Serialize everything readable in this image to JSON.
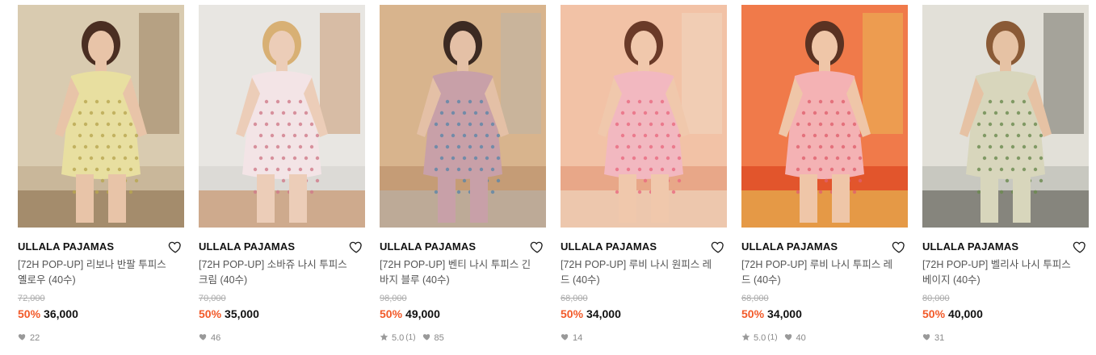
{
  "products": [
    {
      "brand": "ULLALA PAJAMAS",
      "name": "[72H POP-UP] 리보나 반팔 투피스 옐로우 (40수)",
      "original_price": "72,000",
      "discount": "50%",
      "price": "36,000",
      "rating": "",
      "review_count": "",
      "likes": "22",
      "image_alt": "yellow floral short-sleeve two-piece pajama"
    },
    {
      "brand": "ULLALA PAJAMAS",
      "name": "[72H POP-UP] 소바쥬 나시 투피스 크림 (40수)",
      "original_price": "70,000",
      "discount": "50%",
      "price": "35,000",
      "rating": "",
      "review_count": "",
      "likes": "46",
      "image_alt": "cream sleeveless two-piece pajama"
    },
    {
      "brand": "ULLALA PAJAMAS",
      "name": "[72H POP-UP] 벤티 나시 투피스 긴바지 블루 (40수)",
      "original_price": "98,000",
      "discount": "50%",
      "price": "49,000",
      "rating": "5.0",
      "review_count": "(1)",
      "likes": "85",
      "image_alt": "blue plaid sleeveless two-piece long pants pajama"
    },
    {
      "brand": "ULLALA PAJAMAS",
      "name": "[72H POP-UP] 루비 나시 원피스 레드 (40수)",
      "original_price": "68,000",
      "discount": "50%",
      "price": "34,000",
      "rating": "",
      "review_count": "",
      "likes": "14",
      "image_alt": "red floral sleeveless one-piece pajama"
    },
    {
      "brand": "ULLALA PAJAMAS",
      "name": "[72H POP-UP] 루비 나시 투피스 레드 (40수)",
      "original_price": "68,000",
      "discount": "50%",
      "price": "34,000",
      "rating": "5.0",
      "review_count": "(1)",
      "likes": "40",
      "image_alt": "red floral sleeveless two-piece pajama"
    },
    {
      "brand": "ULLALA PAJAMAS",
      "name": "[72H POP-UP] 벨리사 나시 투피스 베이지 (40수)",
      "original_price": "80,000",
      "discount": "50%",
      "price": "40,000",
      "rating": "",
      "review_count": "",
      "likes": "31",
      "image_alt": "beige botanical sleeveless two-piece pajama"
    }
  ],
  "colors": {
    "discount": "#f25a29",
    "text": "#111111",
    "muted": "#888888",
    "strike": "#aaaaaa"
  },
  "icons": {
    "wishlist": "heart-outline-icon",
    "likes": "heart-filled-icon",
    "rating": "star-icon"
  }
}
